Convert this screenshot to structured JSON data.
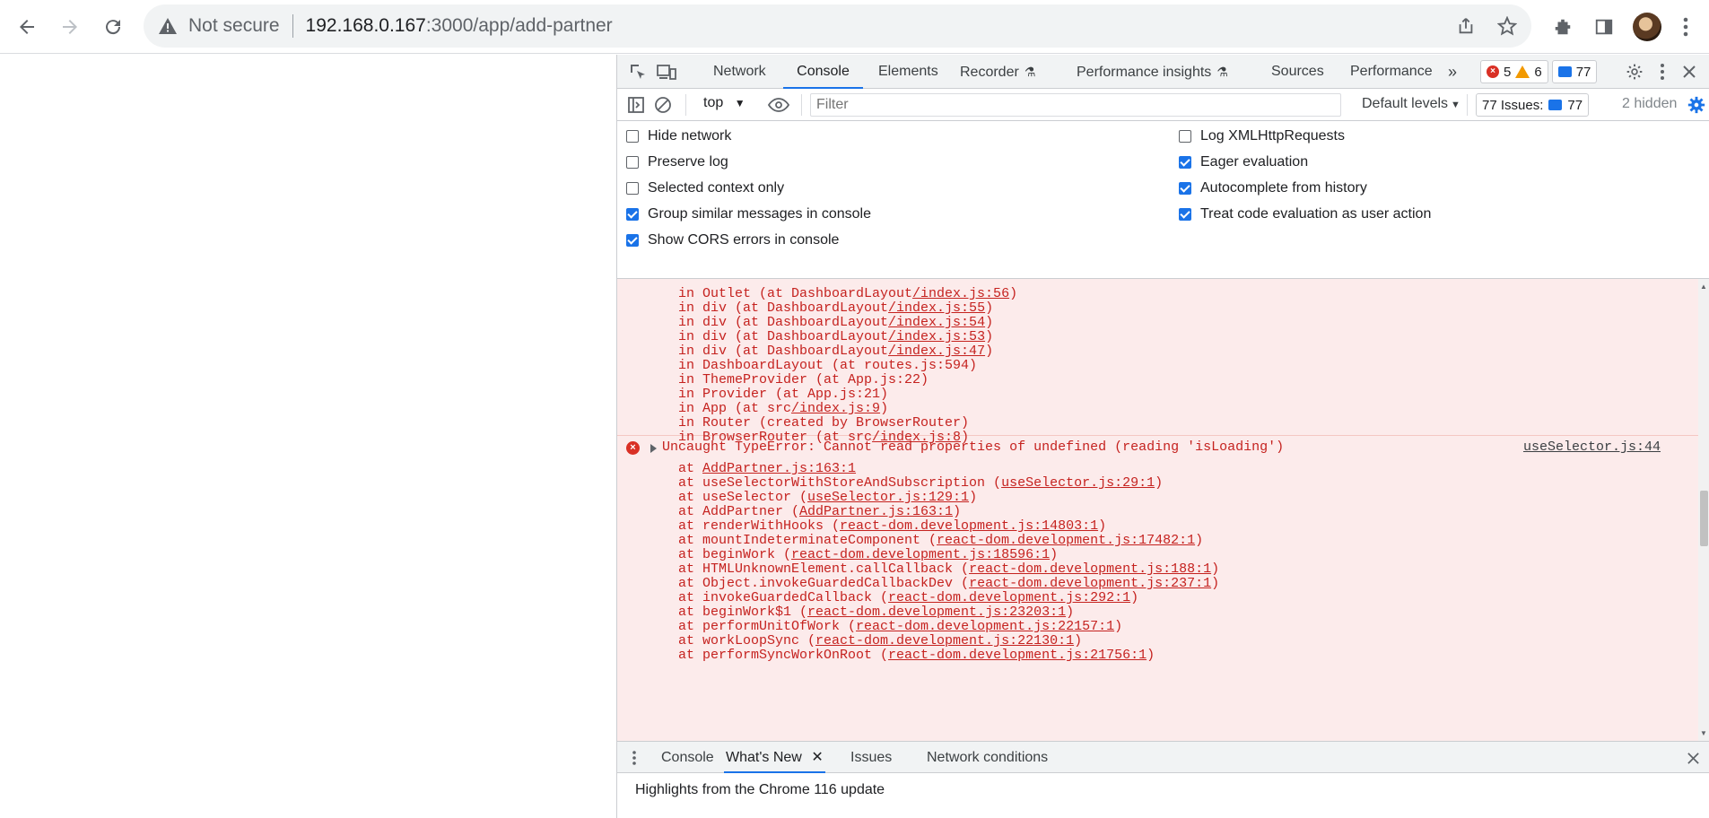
{
  "browser": {
    "not_secure_label": "Not secure",
    "url_host": "192.168.0.167",
    "url_path": ":3000/app/add-partner"
  },
  "devtools": {
    "tabs": [
      "Network",
      "Console",
      "Elements",
      "Recorder",
      "Performance insights",
      "Sources",
      "Performance"
    ],
    "active_tab": "Console",
    "error_count": "5",
    "warning_count": "6",
    "message_count": "77",
    "context": "top",
    "filter_placeholder": "Filter",
    "default_levels": "Default levels",
    "issues_label": "77 Issues:",
    "issues_count": "77",
    "hidden_label": "2 hidden"
  },
  "settings": {
    "left": [
      {
        "label": "Hide network",
        "checked": false
      },
      {
        "label": "Preserve log",
        "checked": false
      },
      {
        "label": "Selected context only",
        "checked": false
      },
      {
        "label": "Group similar messages in console",
        "checked": true
      },
      {
        "label": "Show CORS errors in console",
        "checked": true
      }
    ],
    "right": [
      {
        "label": "Log XMLHttpRequests",
        "checked": false
      },
      {
        "label": "Eager evaluation",
        "checked": true
      },
      {
        "label": "Autocomplete from history",
        "checked": true
      },
      {
        "label": "Treat code evaluation as user action",
        "checked": true
      }
    ]
  },
  "console": {
    "component_stack": [
      {
        "pre": "in Outlet (at DashboardLayout",
        "link": "/index.js:56",
        "post": ")"
      },
      {
        "pre": "in div (at DashboardLayout",
        "link": "/index.js:55",
        "post": ")"
      },
      {
        "pre": "in div (at DashboardLayout",
        "link": "/index.js:54",
        "post": ")"
      },
      {
        "pre": "in div (at DashboardLayout",
        "link": "/index.js:53",
        "post": ")"
      },
      {
        "pre": "in div (at DashboardLayout",
        "link": "/index.js:47",
        "post": ")"
      },
      {
        "pre": "in DashboardLayout (at routes.js:594)",
        "link": "",
        "post": ""
      },
      {
        "pre": "in ThemeProvider (at App.js:22)",
        "link": "",
        "post": ""
      },
      {
        "pre": "in Provider (at App.js:21)",
        "link": "",
        "post": ""
      },
      {
        "pre": "in App (at src",
        "link": "/index.js:9",
        "post": ")"
      },
      {
        "pre": "in Router (created by BrowserRouter)",
        "link": "",
        "post": ""
      },
      {
        "pre": "in BrowserRouter (at src",
        "link": "/index.js:8",
        "post": ")"
      }
    ],
    "error_title": "Uncaught TypeError: Cannot read properties of undefined (reading 'isLoading')",
    "error_source": "useSelector.js:44",
    "error_stack": [
      {
        "pre": "at ",
        "link": "AddPartner.js:163:1",
        "post": ""
      },
      {
        "pre": "at useSelectorWithStoreAndSubscription (",
        "link": "useSelector.js:29:1",
        "post": ")"
      },
      {
        "pre": "at useSelector (",
        "link": "useSelector.js:129:1",
        "post": ")"
      },
      {
        "pre": "at AddPartner (",
        "link": "AddPartner.js:163:1",
        "post": ")"
      },
      {
        "pre": "at renderWithHooks (",
        "link": "react-dom.development.js:14803:1",
        "post": ")"
      },
      {
        "pre": "at mountIndeterminateComponent (",
        "link": "react-dom.development.js:17482:1",
        "post": ")"
      },
      {
        "pre": "at beginWork (",
        "link": "react-dom.development.js:18596:1",
        "post": ")"
      },
      {
        "pre": "at HTMLUnknownElement.callCallback (",
        "link": "react-dom.development.js:188:1",
        "post": ")"
      },
      {
        "pre": "at Object.invokeGuardedCallbackDev (",
        "link": "react-dom.development.js:237:1",
        "post": ")"
      },
      {
        "pre": "at invokeGuardedCallback (",
        "link": "react-dom.development.js:292:1",
        "post": ")"
      },
      {
        "pre": "at beginWork$1 (",
        "link": "react-dom.development.js:23203:1",
        "post": ")"
      },
      {
        "pre": "at performUnitOfWork (",
        "link": "react-dom.development.js:22157:1",
        "post": ")"
      },
      {
        "pre": "at workLoopSync (",
        "link": "react-dom.development.js:22130:1",
        "post": ")"
      },
      {
        "pre": "at performSyncWorkOnRoot (",
        "link": "react-dom.development.js:21756:1",
        "post": ")"
      }
    ]
  },
  "drawer": {
    "tabs": [
      "Console",
      "What's New",
      "Issues",
      "Network conditions"
    ],
    "active_tab": "What's New",
    "content": "Highlights from the Chrome 116 update"
  }
}
